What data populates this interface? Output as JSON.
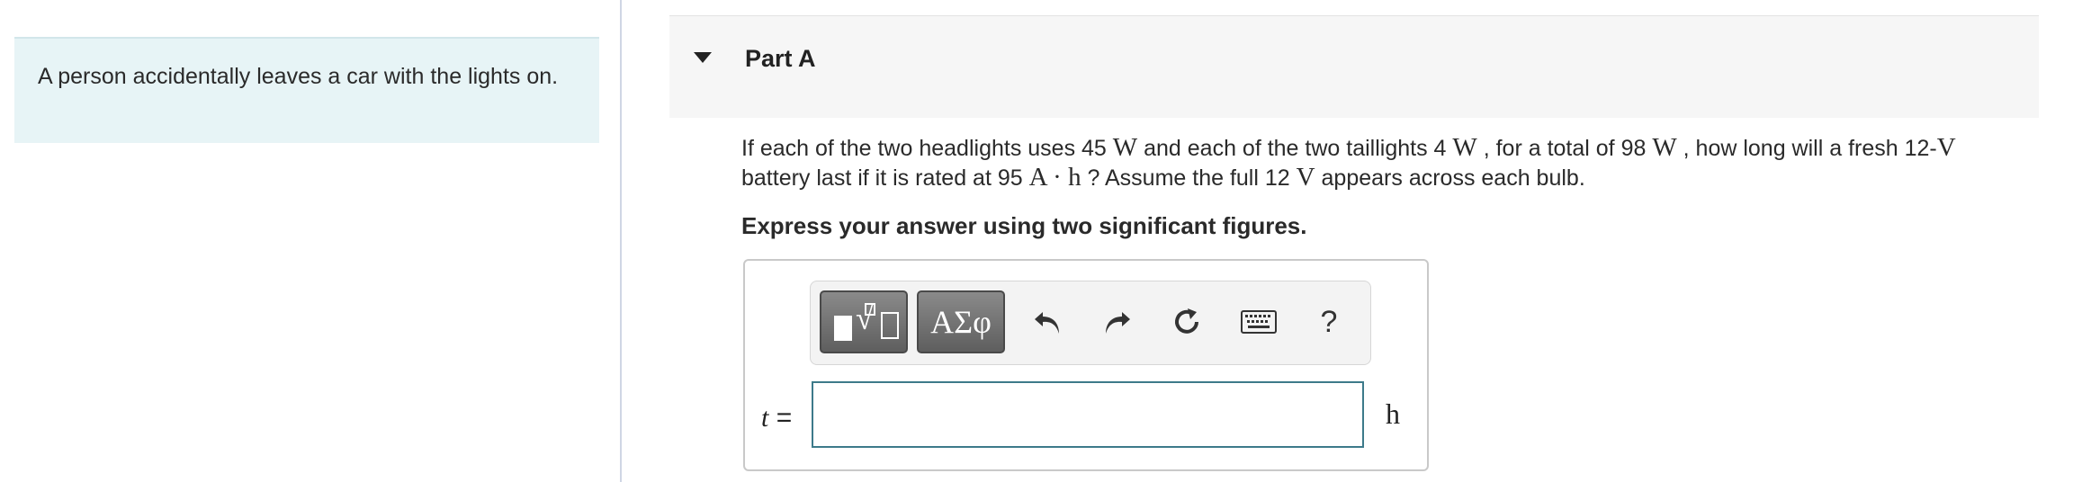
{
  "intro": {
    "text": "A person accidentally leaves a car with the lights on."
  },
  "part": {
    "title": "Part A"
  },
  "question": {
    "s1": "If each of the two headlights uses 45 ",
    "u1": "W",
    "s2": " and each of the two taillights 4 ",
    "u2": "W",
    "s3": " , for a total of 98 ",
    "u3": "W",
    "s4": " , how long will a fresh 12-",
    "u4": "V",
    "s5": "battery last if it is rated at 95 ",
    "u5": "A · h",
    "s6": " ? Assume the full 12 ",
    "u6": "V",
    "s7": " appears across each bulb."
  },
  "instruction": "Express your answer using two significant figures.",
  "toolbar": {
    "greek_label": "ΑΣφ",
    "help_label": "?",
    "icons": [
      "templates-icon",
      "undo-icon",
      "redo-icon",
      "reset-icon",
      "keyboard-icon",
      "help-icon"
    ]
  },
  "answer": {
    "variable": "t",
    "equals": "=",
    "value": "",
    "unit": "h"
  },
  "colors": {
    "intro_bg": "#e7f4f6",
    "header_bg": "#f6f6f6",
    "input_border": "#3d7a8a",
    "toolbar_dark": "#5e5e5e"
  }
}
